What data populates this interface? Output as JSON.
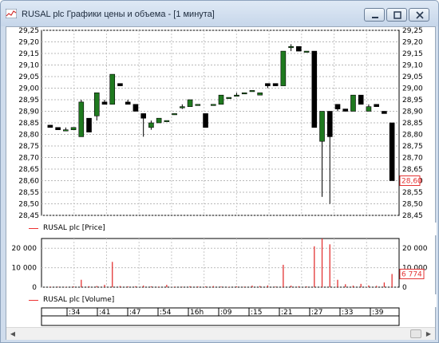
{
  "window": {
    "title": "RUSAL plc Графики цены и объема - [1 минута]"
  },
  "price_panel": {
    "legend": "RUSAL plc [Price]",
    "y_ticks": [
      "29,25",
      "29,20",
      "29,15",
      "29,10",
      "29,05",
      "29,00",
      "28,95",
      "28,90",
      "28,85",
      "28,80",
      "28,75",
      "28,70",
      "28,65",
      "28,60",
      "28,55",
      "28,50",
      "28,45"
    ],
    "last_value": "28,60",
    "colors": {
      "up": "#1f7a1f",
      "down": "#000000",
      "marker": "#e33333"
    }
  },
  "volume_panel": {
    "legend": "RUSAL plc [Volume]",
    "y_ticks": [
      "20 000",
      "10 000",
      "0"
    ],
    "last_value": "6 774",
    "color": "#e33333"
  },
  "time_axis": {
    "labels": [
      ":34",
      ":41",
      ":47",
      ":54",
      "16h",
      ":09",
      ":15",
      ":21",
      ":27",
      ":33",
      ":39"
    ]
  },
  "chart_data": [
    {
      "type": "candlestick",
      "title": "RUSAL plc [Price]",
      "ylim": [
        28.45,
        29.25
      ],
      "candles": [
        {
          "o": 28.84,
          "h": 28.84,
          "l": 28.83,
          "c": 28.83
        },
        {
          "o": 28.83,
          "h": 28.83,
          "l": 28.82,
          "c": 28.82
        },
        {
          "o": 28.82,
          "h": 28.83,
          "l": 28.82,
          "c": 28.82
        },
        {
          "o": 28.82,
          "h": 28.83,
          "l": 28.82,
          "c": 28.83
        },
        {
          "o": 28.79,
          "h": 28.95,
          "l": 28.79,
          "c": 28.94
        },
        {
          "o": 28.87,
          "h": 28.87,
          "l": 28.81,
          "c": 28.81
        },
        {
          "o": 28.88,
          "h": 28.98,
          "l": 28.86,
          "c": 28.98
        },
        {
          "o": 28.94,
          "h": 28.95,
          "l": 28.93,
          "c": 28.93
        },
        {
          "o": 28.93,
          "h": 29.06,
          "l": 28.93,
          "c": 29.06
        },
        {
          "o": 29.02,
          "h": 29.02,
          "l": 29.01,
          "c": 29.01
        },
        {
          "o": 28.94,
          "h": 28.95,
          "l": 28.93,
          "c": 28.93
        },
        {
          "o": 28.93,
          "h": 28.92,
          "l": 28.92,
          "c": 28.9
        },
        {
          "o": 28.89,
          "h": 28.89,
          "l": 28.79,
          "c": 28.87
        },
        {
          "o": 28.83,
          "h": 28.86,
          "l": 28.82,
          "c": 28.85
        },
        {
          "o": 28.85,
          "h": 28.87,
          "l": 28.85,
          "c": 28.87
        },
        {
          "o": 28.86,
          "h": 28.86,
          "l": 28.86,
          "c": 28.86
        },
        {
          "o": 28.89,
          "h": 28.89,
          "l": 28.89,
          "c": 28.89
        },
        {
          "o": 28.92,
          "h": 28.93,
          "l": 28.91,
          "c": 28.92
        },
        {
          "o": 28.92,
          "h": 28.95,
          "l": 28.92,
          "c": 28.95
        },
        {
          "o": 28.93,
          "h": 28.93,
          "l": 28.93,
          "c": 28.93
        },
        {
          "o": 28.89,
          "h": 28.89,
          "l": 28.83,
          "c": 28.83
        },
        {
          "o": 28.93,
          "h": 28.93,
          "l": 28.93,
          "c": 28.93
        },
        {
          "o": 28.93,
          "h": 28.97,
          "l": 28.93,
          "c": 28.97
        },
        {
          "o": 28.96,
          "h": 28.96,
          "l": 28.96,
          "c": 28.96
        },
        {
          "o": 28.97,
          "h": 28.98,
          "l": 28.97,
          "c": 28.97
        },
        {
          "o": 28.98,
          "h": 28.98,
          "l": 28.98,
          "c": 28.98
        },
        {
          "o": 28.99,
          "h": 28.99,
          "l": 28.99,
          "c": 28.99
        },
        {
          "o": 28.97,
          "h": 28.98,
          "l": 28.97,
          "c": 28.98
        },
        {
          "o": 29.02,
          "h": 29.02,
          "l": 29.0,
          "c": 29.01
        },
        {
          "o": 29.02,
          "h": 29.02,
          "l": 29.01,
          "c": 29.01
        },
        {
          "o": 29.01,
          "h": 29.16,
          "l": 29.01,
          "c": 29.16
        },
        {
          "o": 29.18,
          "h": 29.19,
          "l": 29.16,
          "c": 29.18
        },
        {
          "o": 29.18,
          "h": 29.18,
          "l": 29.16,
          "c": 29.16
        },
        {
          "o": 29.16,
          "h": 29.16,
          "l": 29.16,
          "c": 29.16
        },
        {
          "o": 29.16,
          "h": 29.16,
          "l": 28.83,
          "c": 28.83
        },
        {
          "o": 28.77,
          "h": 28.9,
          "l": 28.53,
          "c": 28.9
        },
        {
          "o": 28.9,
          "h": 28.9,
          "l": 28.5,
          "c": 28.79
        },
        {
          "o": 28.93,
          "h": 28.93,
          "l": 28.9,
          "c": 28.91
        },
        {
          "o": 28.91,
          "h": 28.91,
          "l": 28.9,
          "c": 28.9
        },
        {
          "o": 28.9,
          "h": 28.97,
          "l": 28.9,
          "c": 28.97
        },
        {
          "o": 28.97,
          "h": 28.97,
          "l": 28.93,
          "c": 28.93
        },
        {
          "o": 28.9,
          "h": 28.93,
          "l": 28.9,
          "c": 28.92
        },
        {
          "o": 28.93,
          "h": 28.93,
          "l": 28.92,
          "c": 28.92
        },
        {
          "o": 28.9,
          "h": 28.9,
          "l": 28.89,
          "c": 28.89
        },
        {
          "o": 28.85,
          "h": 28.85,
          "l": 28.6,
          "c": 28.6
        }
      ]
    },
    {
      "type": "bar",
      "title": "RUSAL plc [Volume]",
      "ylim": [
        0,
        25000
      ],
      "values": [
        300,
        200,
        200,
        400,
        3800,
        500,
        600,
        1200,
        13000,
        600,
        400,
        500,
        800,
        400,
        300,
        1200,
        300,
        200,
        500,
        400,
        400,
        600,
        300,
        200,
        400,
        300,
        800,
        600,
        900,
        300,
        11500,
        800,
        500,
        400,
        21000,
        25000,
        22000,
        3800,
        1500,
        800,
        1700,
        900,
        700,
        2400,
        6774
      ]
    }
  ]
}
